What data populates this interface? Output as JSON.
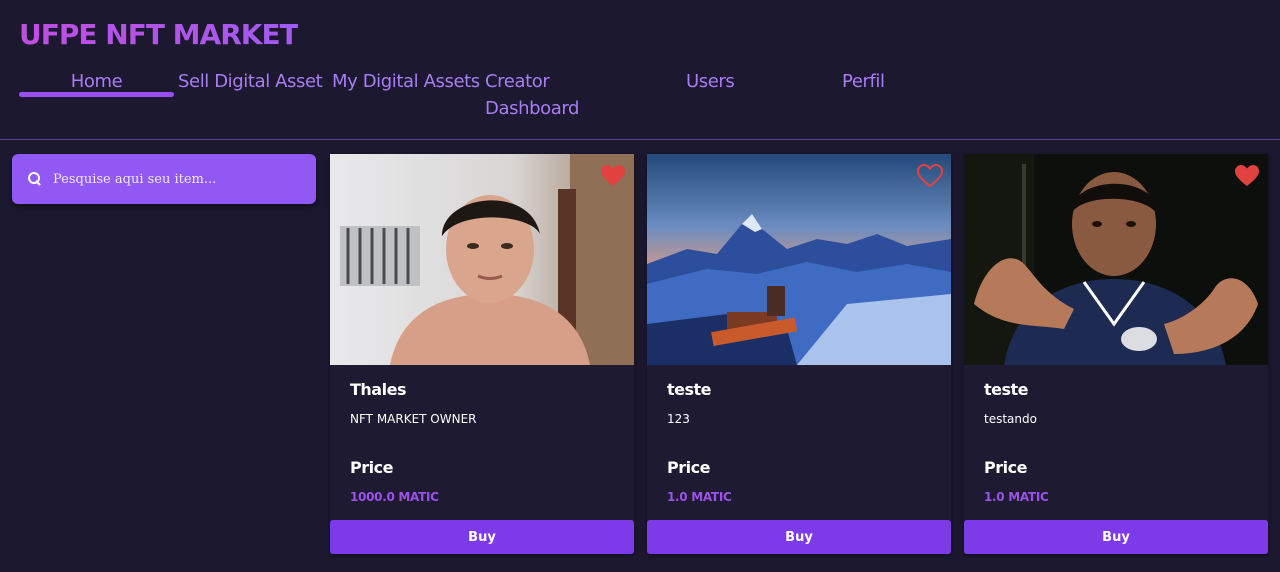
{
  "brand": {
    "title": "UFPE NFT MARKET"
  },
  "nav": {
    "home": "Home",
    "sell": "Sell Digital Asset",
    "my_assets": "My Digital Assets",
    "creator": "Creator Dashboard",
    "users": "Users",
    "perfil": "Perfil",
    "active": "Home"
  },
  "search": {
    "placeholder": "Pesquise aqui seu item..."
  },
  "price_label": "Price",
  "buy_label": "Buy",
  "accent_color": "#7d3ae8",
  "cards": [
    {
      "name": "Thales",
      "description": "NFT MARKET OWNER",
      "price": "1000.0 MATIC",
      "favorited": true,
      "image": "portrait-photo"
    },
    {
      "name": "teste",
      "description": "123",
      "price": "1.0 MATIC",
      "favorited": false,
      "image": "mountain-train-photo"
    },
    {
      "name": "teste",
      "description": "testando",
      "price": "1.0 MATIC",
      "favorited": true,
      "image": "portrait-photo-dark"
    }
  ]
}
